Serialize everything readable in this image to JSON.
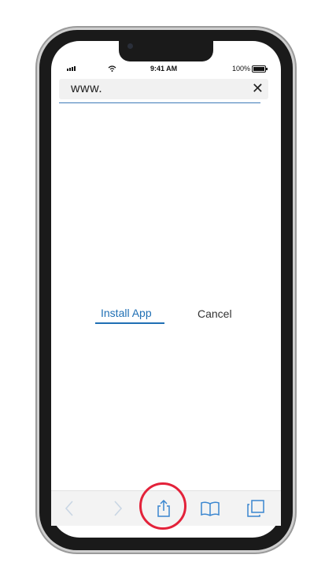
{
  "status_bar": {
    "time": "9:41 AM",
    "battery_percent": "100%",
    "icons": [
      "signal-icon",
      "wifi-icon",
      "battery-icon"
    ]
  },
  "browser": {
    "url_text": "www.",
    "close_icon": "close-icon"
  },
  "content": {
    "install_label": "Install App",
    "cancel_label": "Cancel"
  },
  "toolbar": {
    "icons": [
      "back-arrow-icon",
      "forward-arrow-icon",
      "share-icon",
      "bookmarks-icon",
      "tabs-icon"
    ],
    "highlighted_icon": "share-icon"
  },
  "colors": {
    "link_blue": "#1f6fb4",
    "toolbar_icon_blue": "#3a86d0",
    "highlight_red": "#e3223a",
    "frame_dark": "#1a1a1a"
  }
}
